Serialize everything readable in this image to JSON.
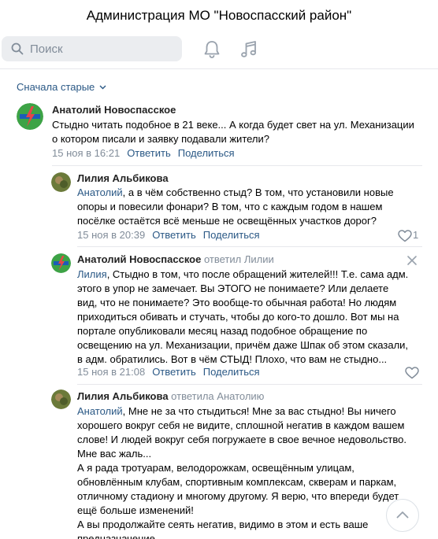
{
  "header": {
    "title": "Администрация МО \"Новоспасский район\""
  },
  "toolbar": {
    "search_placeholder": "Поиск",
    "icons": [
      "search-icon",
      "bell-icon",
      "music-icon"
    ]
  },
  "sort": {
    "label": "Сначала старые"
  },
  "comments": [
    {
      "author": "Анатолий Новоспасское",
      "replied_to": "",
      "mention": "",
      "text": "Стыдно читать подобное в 21 веке... А когда будет свет на ул. Механизации о котором писали и заявку подавали жители?",
      "time": "15 ноя в 16:21",
      "reply": "Ответить",
      "share": "Поделиться"
    },
    {
      "author": "Лилия Альбикова",
      "replied_to": "",
      "mention": "Анатолий",
      "text": ", а в чём собственно стыд? В том, что установили новые опоры и повесили фонари? В том, что с каждым годом в нашем посёлке остаётся всё меньше не освещённых участков дорог?",
      "time": "15 ноя в 20:39",
      "reply": "Ответить",
      "share": "Поделиться",
      "likes": "1"
    },
    {
      "author": "Анатолий Новоспасское",
      "replied_to": "ответил Лилии",
      "mention": "Лилия",
      "text": ", Стыдно в том, что после обращений жителей!!! Т.е. сама адм. этого в упор не замечает. Вы ЭТОГО не понимаете? Или делаете вид, что не понимаете? Это вообще-то обычная работа! Но людям приходиться обивать и стучать, чтобы до кого-то дошло. Вот мы на портале опубликовали месяц назад подобное обращение по освещению на ул. Механизации, причём даже Шпак об этом сказали, в адм. обратились. Вот в чём СТЫД! Плохо, что вам не стыдно...",
      "time": "15 ноя в 21:08",
      "reply": "Ответить",
      "share": "Поделиться"
    },
    {
      "author": "Лилия Альбикова",
      "replied_to": "ответила Анатолию",
      "mention": "Анатолий",
      "text": ", Мне не за что стыдиться! Мне за вас стыдно! Вы ничего хорошего вокруг себя не видите, сплошной негатив в каждом вашем слове! И людей вокруг себя погружаете в свое вечное недовольство. Мне вас жаль...",
      "text2": "А я рада тротуарам, велодорожкам, освещённым улицам, обновлённым клубам, спортивным комплексам, скверам и паркам, отличному стадиону и многому другому. Я верю, что впереди будет ещё больше изменений!",
      "text3": "А вы продолжайте сеять негатив, видимо в этом и есть ваше предназначение..."
    }
  ],
  "colors": {
    "link": "#2a5885",
    "muted": "#818c99",
    "accent_logo": "#e64646"
  }
}
